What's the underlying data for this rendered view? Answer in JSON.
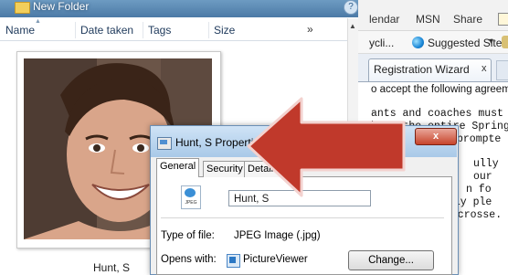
{
  "explorer": {
    "title": "New Folder",
    "help_glyph": "?",
    "columns": [
      "Name",
      "Date taken",
      "Tags",
      "Size"
    ],
    "more_columns_glyph": "»",
    "scroll_up_glyph": "▲",
    "thumbnail_caption": "Hunt, S"
  },
  "browser": {
    "menu": [
      "lendar",
      "MSN",
      "Share"
    ],
    "favorites": {
      "recycle_label": "ycli...",
      "suggested_label": "Suggested Sites",
      "caret": "▾"
    },
    "tab": {
      "label": "Registration Wizard",
      "close_glyph": "x"
    },
    "page_lines": [
      "o accept the following agreeme"
    ],
    "mono_lines": [
      "ants and coaches must ma",
      "hout the entire Spring L",
      "prompte",
      "ully",
      "our",
      "n fo",
      "ply ple",
      "lacrosse."
    ]
  },
  "dialog": {
    "title": "Hunt, S Properties",
    "close_glyph": "x",
    "tabs": [
      "General",
      "Security",
      "Details"
    ],
    "icon_text": "JPEG",
    "name_value": "Hunt, S",
    "type_label": "Type of file:",
    "type_value": "JPEG Image (.jpg)",
    "opens_label": "Opens with:",
    "opens_value": "PictureViewer",
    "change_label": "Change..."
  },
  "colors": {
    "arrow_fill": "#c0392b",
    "arrow_stroke": "#f3d2cf",
    "titlebar": "#5b8ab6"
  }
}
